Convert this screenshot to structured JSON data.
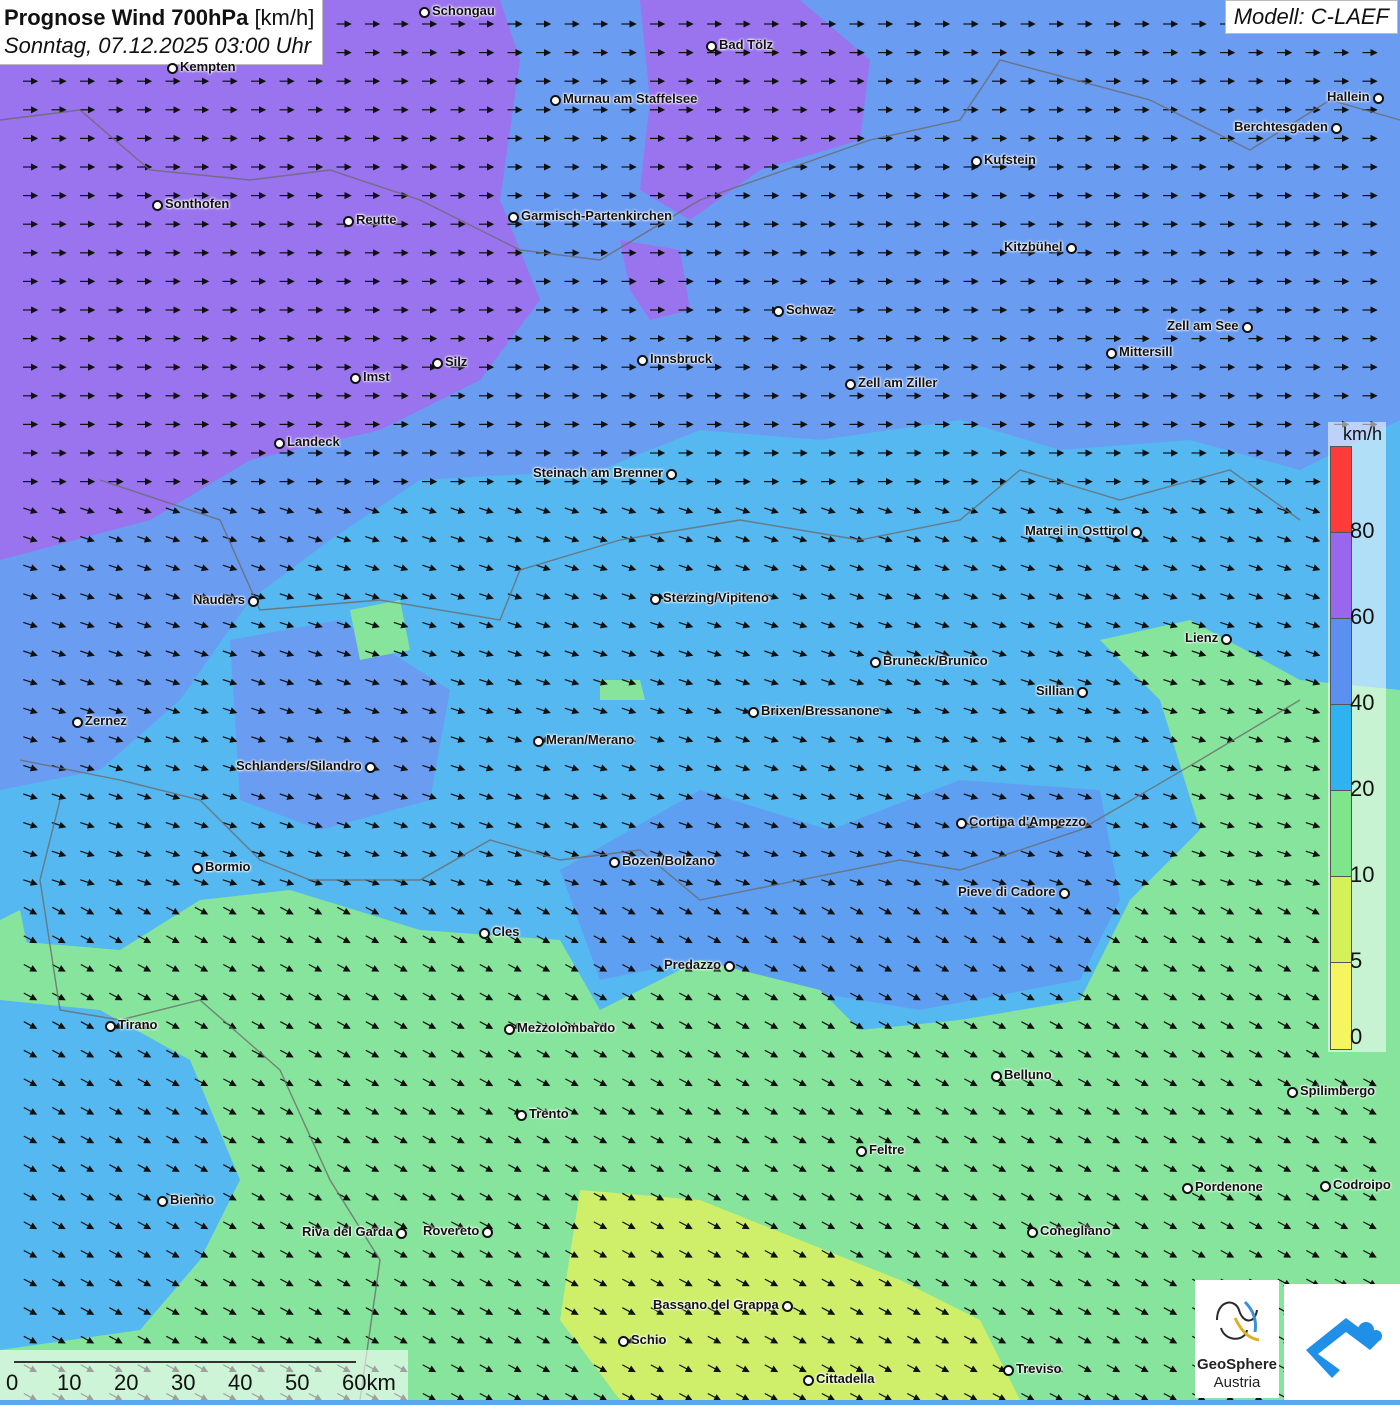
{
  "header": {
    "title_bold": "Prognose Wind 700hPa",
    "title_unit": "[km/h]",
    "subtitle": "Sonntag, 07.12.2025 03:00 Uhr"
  },
  "model": {
    "label": "Modell: C-LAEF"
  },
  "legend": {
    "unit": "km/h",
    "ticks": [
      "80",
      "60",
      "40",
      "20",
      "10",
      "5",
      "0"
    ],
    "colors": [
      "#ff3a3a",
      "#9966ee",
      "#5b8ff0",
      "#2fb3f0",
      "#7ee58a",
      "#d6f05a",
      "#f5f560"
    ]
  },
  "scalebar": {
    "labels": [
      "0",
      "10",
      "20",
      "30",
      "40",
      "50",
      "60km"
    ]
  },
  "logos": {
    "geosphere_line1": "GeoSphere",
    "geosphere_line2": "Austria"
  },
  "cities": [
    {
      "name": "Schongau"
    },
    {
      "name": "Bad Tölz"
    },
    {
      "name": "Kempten"
    },
    {
      "name": "Murnau am Staffelsee"
    },
    {
      "name": "Hallein"
    },
    {
      "name": "Berchtesgaden"
    },
    {
      "name": "Kufstein"
    },
    {
      "name": "Sonthofen"
    },
    {
      "name": "Reutte"
    },
    {
      "name": "Garmisch-Partenkirchen"
    },
    {
      "name": "Kitzbühel"
    },
    {
      "name": "Schwaz"
    },
    {
      "name": "Zell am See"
    },
    {
      "name": "Mittersill"
    },
    {
      "name": "Silz"
    },
    {
      "name": "Innsbruck"
    },
    {
      "name": "Imst"
    },
    {
      "name": "Zell am Ziller"
    },
    {
      "name": "Landeck"
    },
    {
      "name": "Steinach am Brenner"
    },
    {
      "name": "Matrei in Osttirol"
    },
    {
      "name": "Nauders"
    },
    {
      "name": "Sterzing/Vipiteno"
    },
    {
      "name": "Lienz"
    },
    {
      "name": "Bruneck/Brunico"
    },
    {
      "name": "Sillian"
    },
    {
      "name": "Brixen/Bressanone"
    },
    {
      "name": "Zernez"
    },
    {
      "name": "Meran/Merano"
    },
    {
      "name": "Schlanders/Silandro"
    },
    {
      "name": "Cortina d'Ampezzo"
    },
    {
      "name": "Bozen/Bolzano"
    },
    {
      "name": "Bormio"
    },
    {
      "name": "Pieve di Cadore"
    },
    {
      "name": "Cles"
    },
    {
      "name": "Predazzo"
    },
    {
      "name": "Tirano"
    },
    {
      "name": "Mezzolombardo"
    },
    {
      "name": "Belluno"
    },
    {
      "name": "Spilimbergo"
    },
    {
      "name": "Trento"
    },
    {
      "name": "Feltre"
    },
    {
      "name": "Pordenone"
    },
    {
      "name": "Codroipo"
    },
    {
      "name": "Bienno"
    },
    {
      "name": "Riva del Garda"
    },
    {
      "name": "Rovereto"
    },
    {
      "name": "Conegliano"
    },
    {
      "name": "Bassano del Grappa"
    },
    {
      "name": "Schio"
    },
    {
      "name": "Treviso"
    },
    {
      "name": "Cittadella"
    }
  ]
}
